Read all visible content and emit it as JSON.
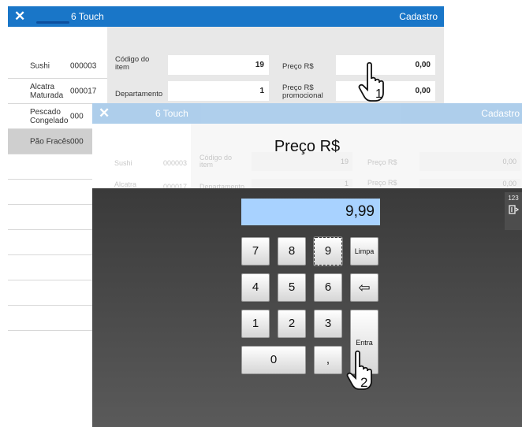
{
  "back_window": {
    "app_title": "6 Touch",
    "right_title": "Cadastro",
    "items": [
      {
        "name": "Sushi",
        "code": "000003"
      },
      {
        "name": "Alcatra Maturada",
        "code": "000017"
      },
      {
        "name": "Pescado Congelado",
        "code": "000"
      },
      {
        "name": "Pão Fracês",
        "code": "000",
        "selected": true
      }
    ],
    "form": {
      "codigo_label": "Código do item",
      "codigo_value": "19",
      "departamento_label": "Departamento",
      "departamento_value": "1",
      "preco_label": "Preço R$",
      "preco_value": "0,00",
      "preco_promo_label": "Preço R$ promocional",
      "preco_promo_value": "0,00"
    },
    "hand_step": "1"
  },
  "front_window": {
    "app_title": "6 Touch",
    "right_title": "Cadastro",
    "dialog_title": "Preço R$",
    "ghost": {
      "sushi": "Sushi",
      "sushi_code": "000003",
      "alcatra": "Alcatra",
      "alcatra_code": "000017",
      "codigo_label": "Código do item",
      "codigo_value": "19",
      "depto_label": "Departamento",
      "depto_value": "1",
      "preco_label": "Preço R$",
      "preco_value": "0,00",
      "preco_promo_label": "Preço R$",
      "preco_promo_value": "0,00"
    },
    "keypad": {
      "display_value": "9,99",
      "keys": {
        "k7": "7",
        "k8": "8",
        "k9": "9",
        "k4": "4",
        "k5": "5",
        "k6": "6",
        "k1": "1",
        "k2": "2",
        "k3": "3",
        "k0": "0",
        "comma": ",",
        "clear": "Limpa",
        "enter": "Entra",
        "backspace_icon": "⇦"
      }
    },
    "side_panel_label": "123",
    "hand_step": "2"
  },
  "icons": {
    "close": "✕",
    "hand": "pointing-hand-icon",
    "keyboard": "keyboard-icon"
  }
}
